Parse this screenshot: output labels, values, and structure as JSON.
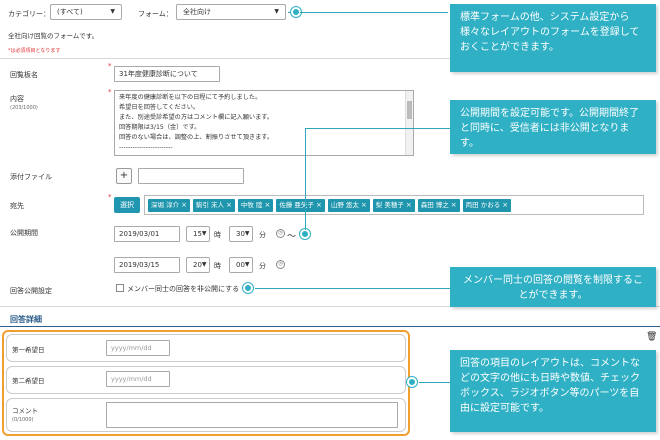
{
  "filter": {
    "category_label": "カテゴリー：",
    "category_value": "(すべて)",
    "form_label": "フォーム：",
    "form_value": "全社向け"
  },
  "form_desc": "全社向け回覧のフォームです。",
  "required_note": "*は必須項目となります",
  "fields": {
    "title_label": "回覧板名",
    "title_value": "31年度健康診断について",
    "content_label": "内容",
    "content_count": "(203/1000)",
    "content_lines": [
      "来年度の健康診断を以下の日程にて予約しました。",
      "希望日を回答してください。",
      "また、別途受診希望の方はコメント欄に記入願います。",
      "回答期限は3/15（金）です。",
      "回答のない場合は、調整の上、割振りさせて頂きます。",
      "------------------------"
    ],
    "attach_label": "添付ファイル",
    "attach_plus": "+",
    "dest_label": "宛先",
    "dest_select": "選択",
    "dest_tags": [
      "深堀 淳介",
      "駒引 末人",
      "中牧 陸",
      "佐藤 亜矢子",
      "山野 悠太",
      "梨 美穂子",
      "森田 博之",
      "両田 かおる"
    ],
    "period_label": "公開期間",
    "start_date": "2019/03/01",
    "start_hour": "15",
    "start_min": "30",
    "end_date": "2019/03/15",
    "end_hour": "20",
    "end_min": "00",
    "hour_unit": "時",
    "min_unit": "分",
    "tilde": "～",
    "mutual_label": "回答公開設定",
    "mutual_check": "メンバー同士の回答を非公開にする"
  },
  "answer": {
    "section_title": "回答詳細",
    "rows": [
      {
        "label": "第一希望日",
        "placeholder": "yyyy/mm/dd"
      },
      {
        "label": "第二希望日",
        "placeholder": "yyyy/mm/dd"
      }
    ],
    "comment_label": "コメント",
    "comment_count": "(0/1000)"
  },
  "callouts": {
    "c1": "標準フォームの他、システム設定から様々なレイアウトのフォームを登録しておくことができます。",
    "c2": "公開期間を設定可能です。公開期間終了と同時に、受信者には非公開となります。",
    "c3": "メンバー同士の回答の閲覧を制限することができます。",
    "c4": "回答の項目のレイアウトは、コメントなどの文字の他にも日時や数値、チェックボックス、ラジオボタン等のパーツを自由に設定可能です。"
  },
  "colors": {
    "callout": "#2fb0c4",
    "highlight_box": "#f0a030",
    "tag": "#1f96ad"
  }
}
